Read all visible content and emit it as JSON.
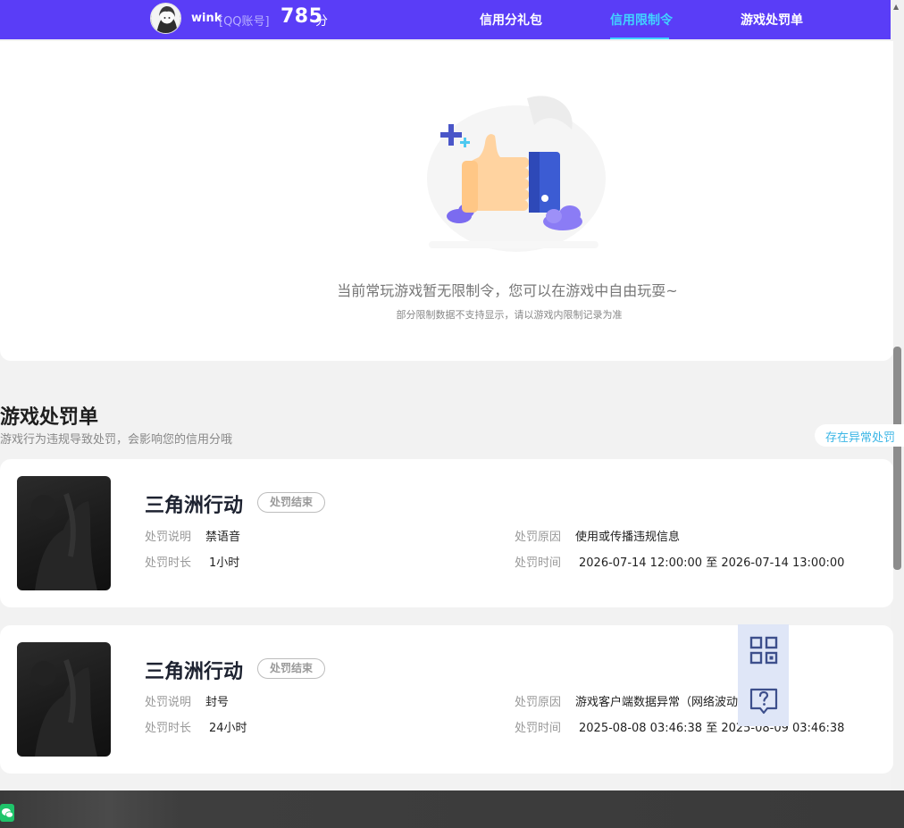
{
  "header": {
    "username": "wink",
    "account_type": "[QQ账号]",
    "score": "785",
    "score_unit": "分",
    "tabs": [
      {
        "label": "信用分礼包",
        "active": false
      },
      {
        "label": "信用限制令",
        "active": true
      },
      {
        "label": "游戏处罚单",
        "active": false
      }
    ]
  },
  "restriction": {
    "empty_title": "当前常玩游戏暂无限制令，您可以在游戏中自由玩耍~",
    "empty_subtitle": "部分限制数据不支持显示，请以游戏内限制记录为准"
  },
  "penalties": {
    "title": "游戏处罚单",
    "subtitle": "游戏行为违规导致处罚，会影响您的信用分哦",
    "abnormal_button": "存在异常处罚",
    "labels": {
      "desc": "处罚说明",
      "duration": "处罚时长",
      "reason": "处罚原因",
      "time": "处罚时间"
    },
    "items": [
      {
        "game": "三角洲行动",
        "status": "处罚结束",
        "desc": "禁语音",
        "duration": "1小时",
        "reason": "使用或传播违规信息",
        "time": "2026-07-14 12:00:00 至 2026-07-14 13:00:00"
      },
      {
        "game": "三角洲行动",
        "status": "处罚结束",
        "desc": "封号",
        "duration": "24小时",
        "reason": "游戏客户端数据异常（网络波动等原因）",
        "time": "2025-08-08 03:46:38 至 2025-08-09 03:46:38"
      }
    ]
  },
  "floating_tools": [
    {
      "icon": "qr-code-icon"
    },
    {
      "icon": "help-chat-icon"
    }
  ],
  "colors": {
    "brand": "#5a3df7",
    "active_tab": "#41d3ff",
    "link": "#3bb6e6"
  }
}
